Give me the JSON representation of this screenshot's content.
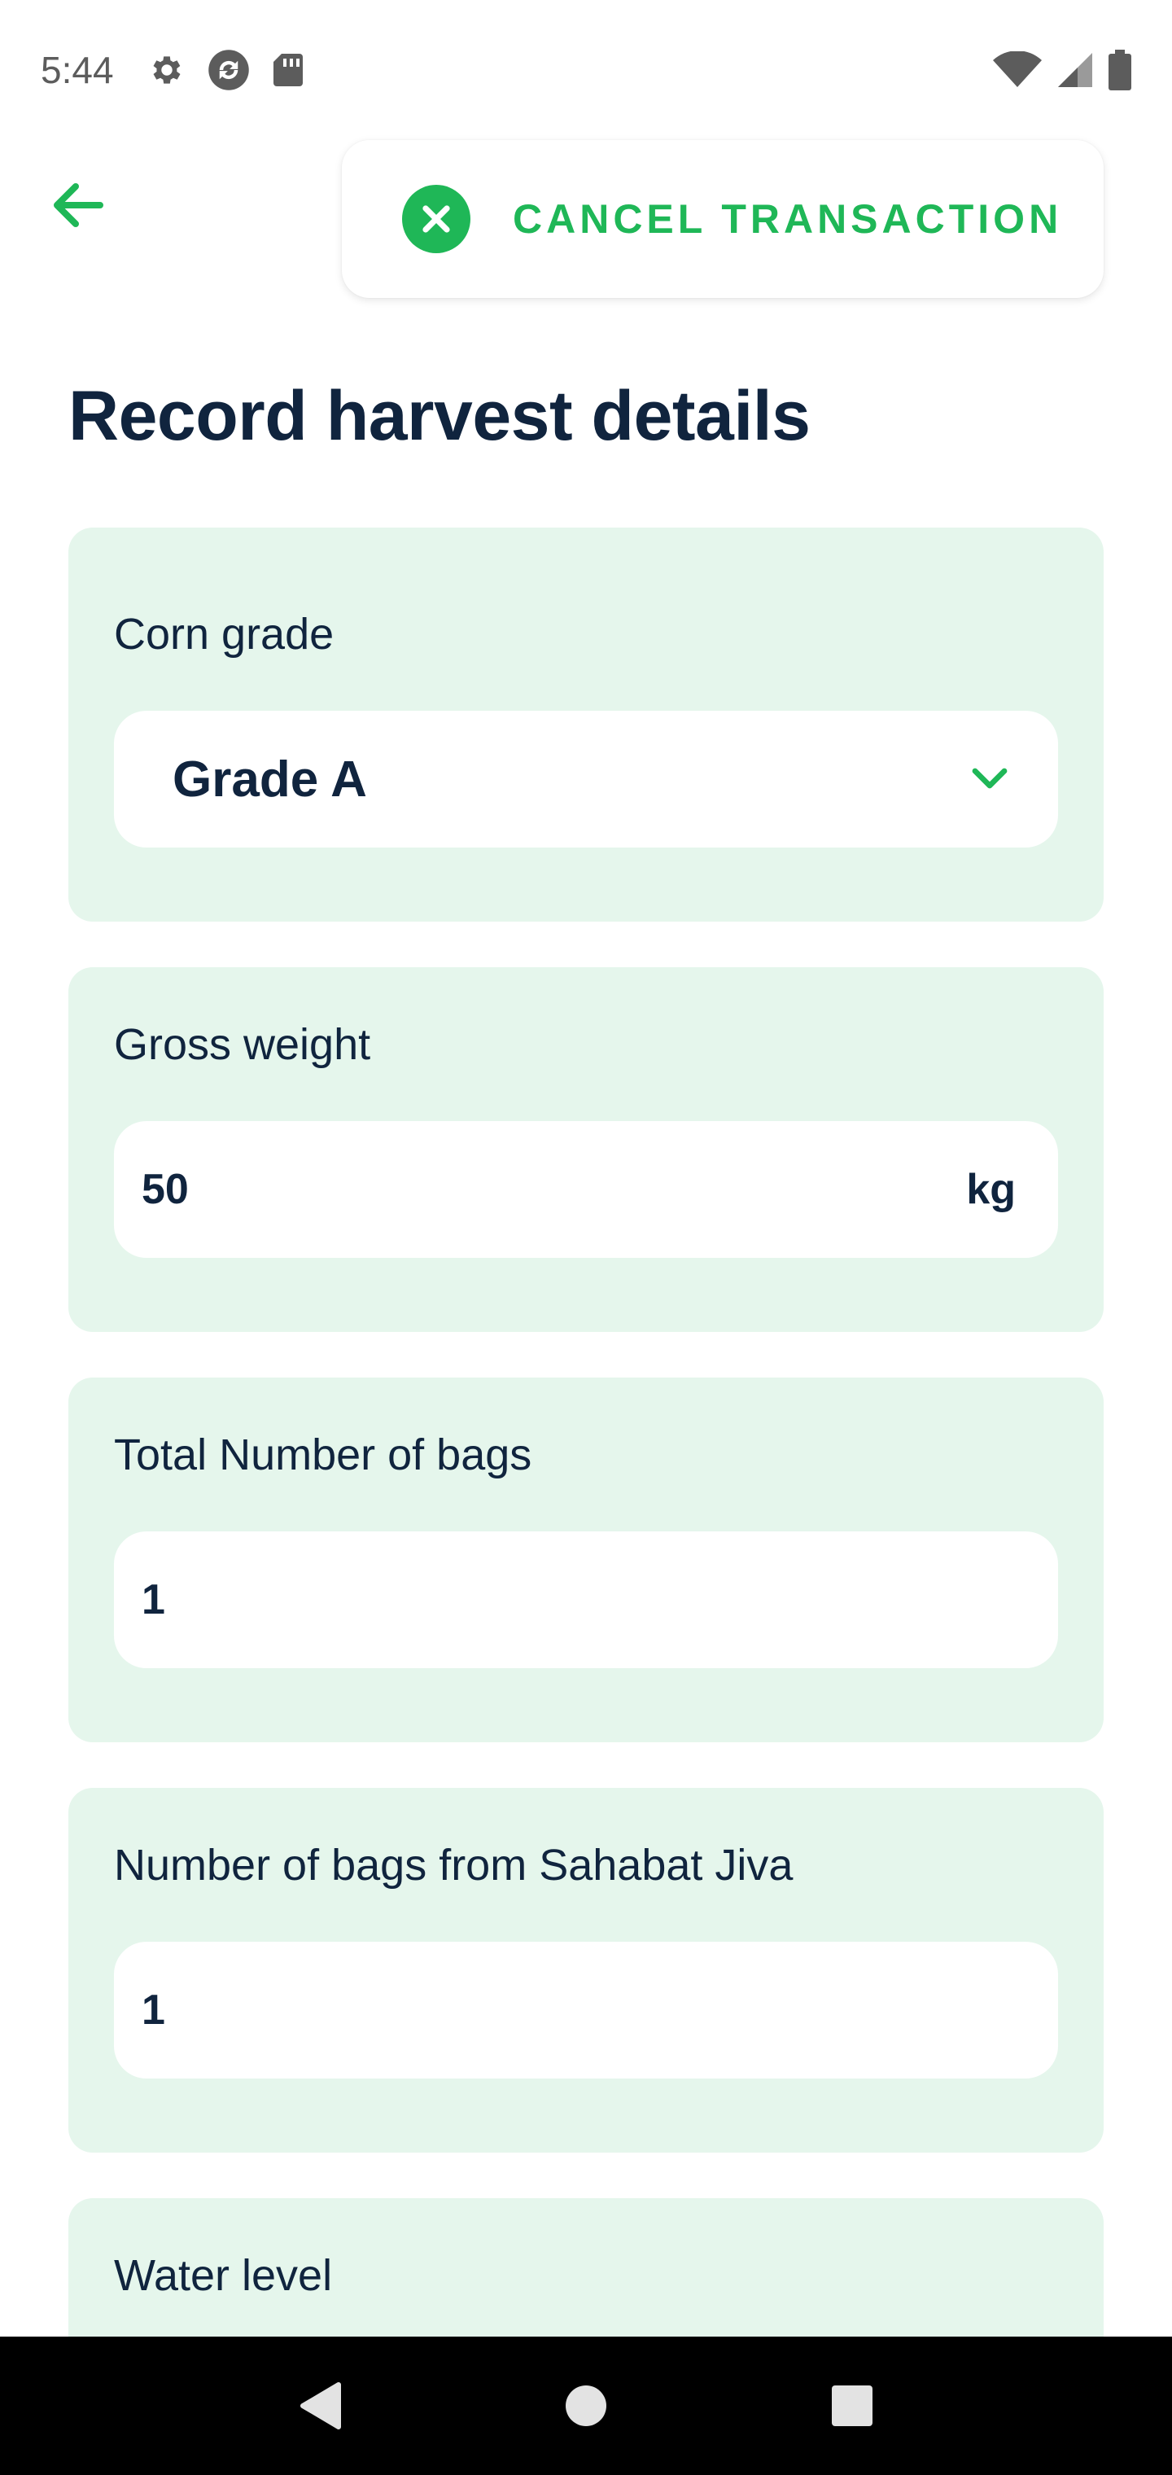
{
  "status_bar": {
    "time": "5:44",
    "left_icons": [
      "gear-icon",
      "sync-icon",
      "sd-card-icon"
    ],
    "right_icons": [
      "wifi-icon",
      "cell-signal-icon",
      "battery-icon"
    ]
  },
  "header": {
    "back_icon": "arrow-left-icon",
    "cancel_label": "CANCEL TRANSACTION",
    "cancel_icon": "close-circle-icon"
  },
  "page": {
    "title": "Record harvest details"
  },
  "form": {
    "corn_grade": {
      "label": "Corn grade",
      "value": "Grade A"
    },
    "gross_weight": {
      "label": "Gross weight",
      "value": "50",
      "unit": "kg"
    },
    "total_bags": {
      "label": "Total Number of bags",
      "value": "1"
    },
    "bags_sahabat_jiva": {
      "label": "Number of bags from Sahabat Jiva",
      "value": "1"
    },
    "water_level": {
      "label": "Water level"
    }
  },
  "nav": {
    "back": "triangle-back-icon",
    "home": "circle-home-icon",
    "recents": "square-recents-icon"
  },
  "colors": {
    "accent": "#1fb757",
    "card_bg": "#e5f6ec",
    "text": "#10243e"
  }
}
